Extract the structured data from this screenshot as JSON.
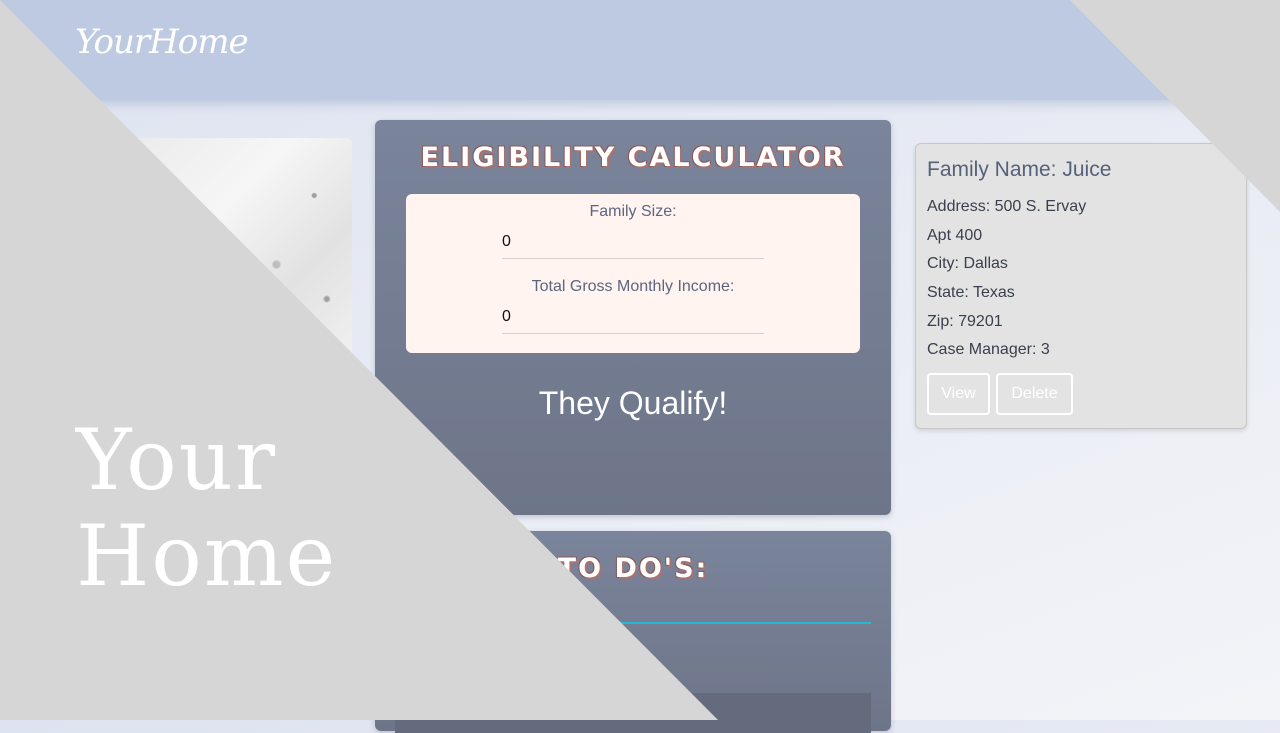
{
  "header": {
    "brand": "YourHome"
  },
  "calculator": {
    "title": "ELIGIBILITY CALCULATOR",
    "family_size_label": "Family Size:",
    "family_size_value": "0",
    "income_label": "Total Gross Monthly Income:",
    "income_value": "0",
    "result": "They Qualify!"
  },
  "todos": {
    "title": "TO DO'S:"
  },
  "family_card": {
    "title": "Family Name: Juice",
    "address": "Address: 500 S. Ervay",
    "apt": "Apt 400",
    "city": "City: Dallas",
    "state": "State: Texas",
    "zip": "Zip: 79201",
    "case_manager": "Case Manager: 3",
    "view_label": "View",
    "delete_label": "Delete"
  },
  "overlay": {
    "line1": "Your",
    "line2": "Home"
  },
  "colors": {
    "header_bg": "#bec9e2",
    "card_bg": "#7a849a",
    "form_bg": "#fff4ef",
    "overlay_gray": "#d6d6d6",
    "accent_line": "#28b8d6"
  }
}
